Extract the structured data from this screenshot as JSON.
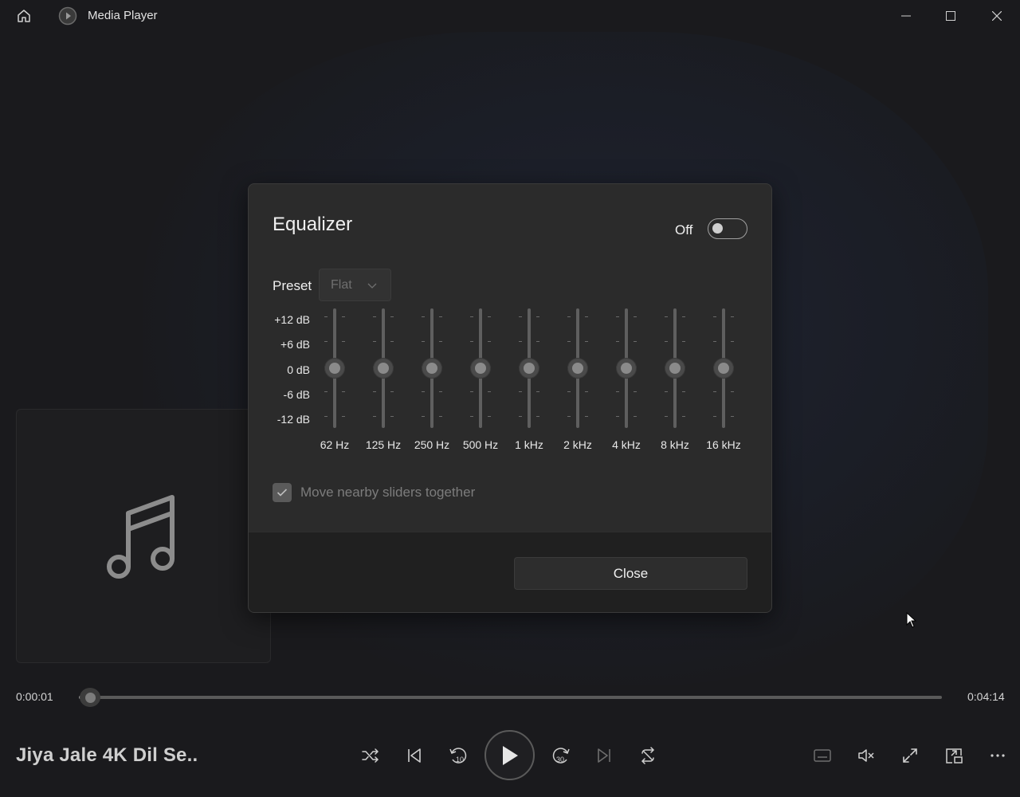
{
  "app": {
    "title": "Media Player"
  },
  "equalizer": {
    "title": "Equalizer",
    "toggle_label": "Off",
    "enabled": false,
    "preset_label": "Preset",
    "preset_value": "Flat",
    "db_labels": [
      "+12 dB",
      "+6 dB",
      "0 dB",
      "-6 dB",
      "-12 dB"
    ],
    "bands": [
      {
        "freq": "62 Hz",
        "gain_db": 0
      },
      {
        "freq": "125 Hz",
        "gain_db": 0
      },
      {
        "freq": "250 Hz",
        "gain_db": 0
      },
      {
        "freq": "500 Hz",
        "gain_db": 0
      },
      {
        "freq": "1 kHz",
        "gain_db": 0
      },
      {
        "freq": "2 kHz",
        "gain_db": 0
      },
      {
        "freq": "4 kHz",
        "gain_db": 0
      },
      {
        "freq": "8 kHz",
        "gain_db": 0
      },
      {
        "freq": "16 kHz",
        "gain_db": 0
      }
    ],
    "move_nearby_label": "Move nearby sliders together",
    "move_nearby_checked": true,
    "close_label": "Close"
  },
  "player": {
    "current_time": "0:00:01",
    "total_time": "0:04:14",
    "progress_fraction": 0.004,
    "song_title": "Jiya Jale 4K Dil Se.."
  },
  "icons": {
    "home": "home-icon",
    "app": "media-player-icon",
    "shuffle": "shuffle-icon",
    "previous": "previous-track-icon",
    "rewind": "rewind-10-icon",
    "play": "play-icon",
    "forward": "forward-30-icon",
    "next": "next-track-icon",
    "repeat": "repeat-icon",
    "captions": "captions-icon",
    "volume": "volume-muted-icon",
    "fullscreen": "fullscreen-icon",
    "miniplayer": "miniplayer-icon",
    "more": "more-options-icon"
  },
  "colors": {
    "background": "#1a1a1d",
    "dialog": "#2b2b2b",
    "footer": "#202020"
  }
}
